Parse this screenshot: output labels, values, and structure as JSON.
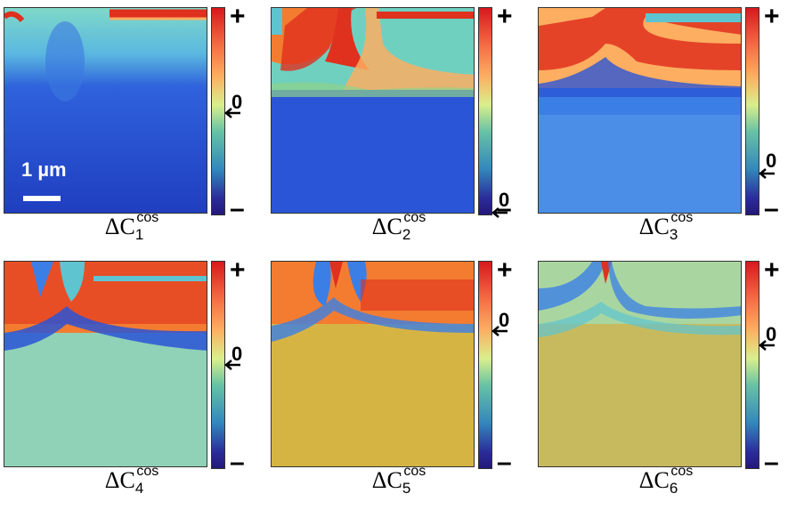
{
  "scale_bar": {
    "label": "1 µm"
  },
  "colorbar": {
    "max_label": "+",
    "min_label": "–",
    "zero_label": "0"
  },
  "colors": {
    "red": "#e0301e",
    "orange": "#f47c30",
    "green": "#8fd28a",
    "cyan": "#5ec4d0",
    "blue": "#2a55d6",
    "navy": "#24177a"
  },
  "panels": [
    {
      "symbol": "ΔC",
      "sub": "1",
      "sup": "cos",
      "zero_level": 0.57
    },
    {
      "symbol": "ΔC",
      "sub": "2",
      "sup": "cos",
      "zero_level": 0.98
    },
    {
      "symbol": "ΔC",
      "sub": "3",
      "sup": "cos",
      "zero_level": 0.74
    },
    {
      "symbol": "ΔC",
      "sub": "4",
      "sup": "cos",
      "zero_level": 0.52
    },
    {
      "symbol": "ΔC",
      "sub": "5",
      "sup": "cos",
      "zero_level": 0.32
    },
    {
      "symbol": "ΔC",
      "sub": "6",
      "sup": "cos",
      "zero_level": 0.37
    }
  ]
}
